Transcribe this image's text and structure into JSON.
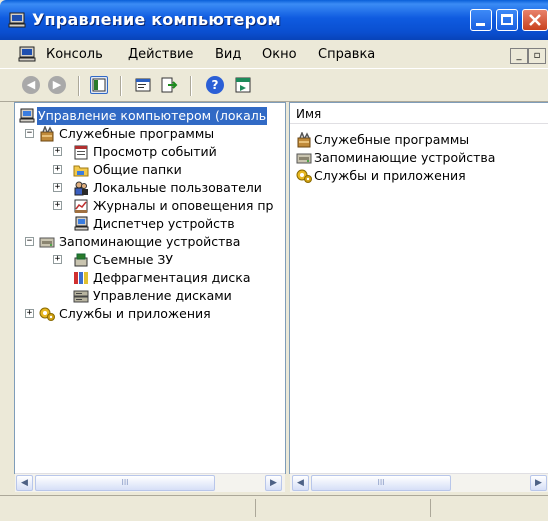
{
  "window": {
    "title": "Управление компьютером"
  },
  "menu": {
    "items": [
      {
        "label": "Консоль"
      },
      {
        "label": "Действие"
      },
      {
        "label": "Вид"
      },
      {
        "label": "Окно"
      },
      {
        "label": "Справка"
      }
    ]
  },
  "tree": {
    "root": "Управление компьютером (локаль",
    "items": [
      {
        "label": "Служебные программы",
        "icon": "tools-icon"
      },
      {
        "label": "Просмотр событий",
        "icon": "event-viewer-icon"
      },
      {
        "label": "Общие папки",
        "icon": "shared-folder-icon"
      },
      {
        "label": "Локальные пользователи",
        "icon": "users-icon"
      },
      {
        "label": "Журналы и оповещения пр",
        "icon": "performance-logs-icon"
      },
      {
        "label": "Диспетчер устройств",
        "icon": "device-manager-icon"
      },
      {
        "label": "Запоминающие устройства",
        "icon": "storage-icon"
      },
      {
        "label": "Съемные ЗУ",
        "icon": "removable-storage-icon"
      },
      {
        "label": "Дефрагментация диска",
        "icon": "defrag-icon"
      },
      {
        "label": "Управление дисками",
        "icon": "disk-management-icon"
      },
      {
        "label": "Службы и приложения",
        "icon": "services-icon"
      }
    ]
  },
  "list": {
    "column": "Имя",
    "items": [
      {
        "label": "Служебные программы"
      },
      {
        "label": "Запоминающие устройства"
      },
      {
        "label": "Службы и приложения"
      }
    ]
  },
  "scrollbar": {
    "grip": "III"
  },
  "colors": {
    "selection": "#316ac5",
    "titlebar": "#0a5fd8",
    "chrome": "#ece9d8"
  }
}
